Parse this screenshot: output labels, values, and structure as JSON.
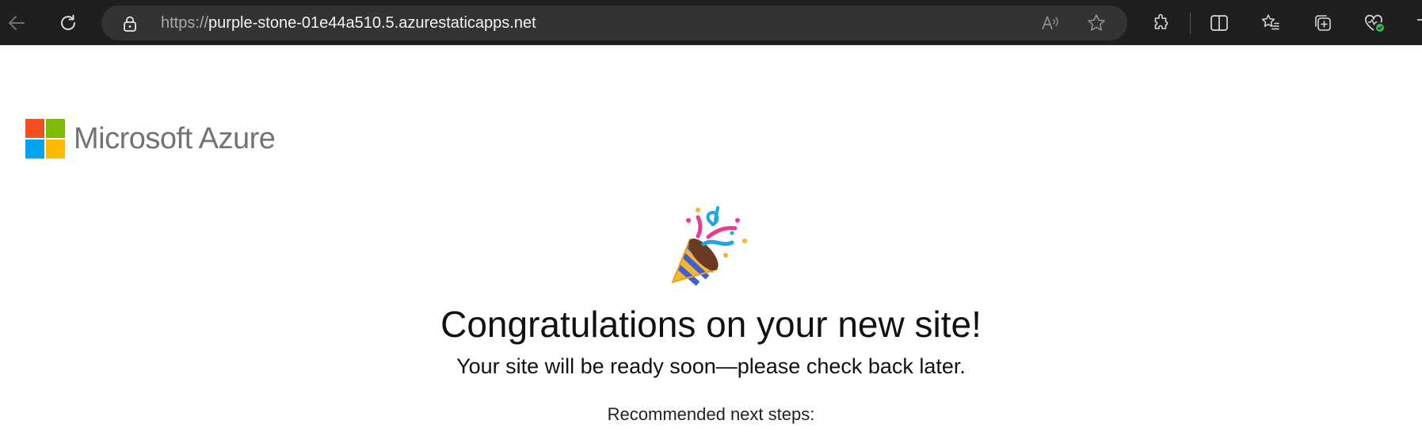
{
  "browser": {
    "url_scheme": "https://",
    "url_host": "purple-stone-01e44a510.5.azurestaticapps.net",
    "icons": [
      "back-icon",
      "refresh-icon",
      "lock-icon",
      "read-aloud-icon",
      "favorite-star-icon",
      "extensions-icon",
      "split-screen-icon",
      "favorites-icon",
      "collections-icon",
      "browser-essentials-icon"
    ],
    "colors": {
      "toolbar": "#1f1f1f",
      "address_bar": "#333333"
    }
  },
  "page": {
    "logo_text": "Microsoft Azure",
    "logo_colors": [
      "#f25022",
      "#7fba00",
      "#00a4ef",
      "#ffb900"
    ],
    "headline": "Congratulations on your new site!",
    "subline": "Your site will be ready soon—please check back later.",
    "next_steps_label": "Recommended next steps:",
    "illustration": "party-popper-icon"
  }
}
